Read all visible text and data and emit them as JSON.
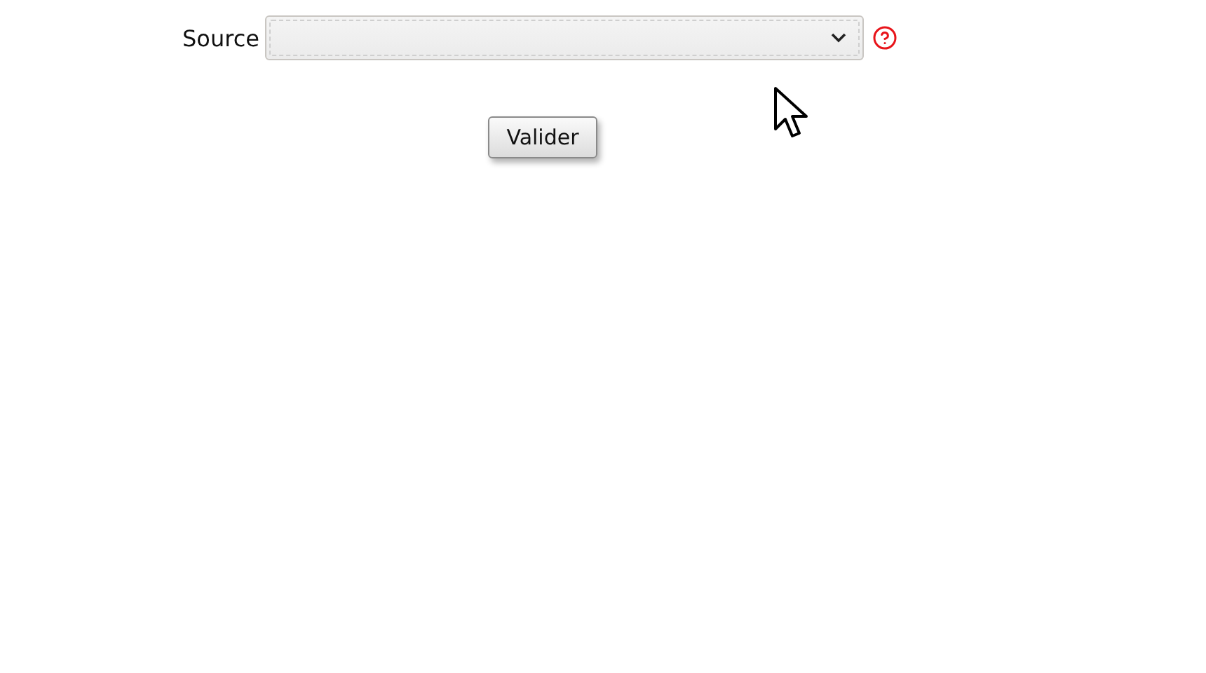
{
  "form": {
    "source_label": "Source",
    "submit_button": "Valider"
  }
}
